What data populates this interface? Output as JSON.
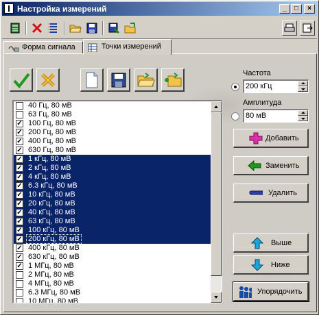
{
  "window": {
    "title": "Настройка измерений"
  },
  "titlebar_buttons": [
    "_",
    "□",
    "×"
  ],
  "toolbar": {
    "tools": [
      {
        "name": "board-icon"
      },
      {
        "name": "delete-icon"
      },
      {
        "name": "list-icon"
      },
      {
        "name": "open-folder-icon"
      },
      {
        "name": "save-icon"
      },
      {
        "name": "save-as-icon"
      },
      {
        "name": "export-folder-icon"
      }
    ],
    "right_tools": [
      {
        "name": "print-icon"
      },
      {
        "name": "exit-icon"
      }
    ]
  },
  "tabs": [
    {
      "label": "Форма сигнала",
      "active": false
    },
    {
      "label": "Точки измерений",
      "active": true
    }
  ],
  "panel_buttons": [
    {
      "name": "check-all-icon"
    },
    {
      "name": "uncheck-all-icon"
    },
    {
      "name": "new-file-icon"
    },
    {
      "name": "save-disk-icon"
    },
    {
      "name": "open-folder-icon"
    },
    {
      "name": "add-folder-icon"
    }
  ],
  "list": {
    "items": [
      {
        "label": "40 Гц, 80 мВ",
        "checked": false,
        "selected": false
      },
      {
        "label": "63 Гц, 80 мВ",
        "checked": false,
        "selected": false
      },
      {
        "label": "100 Гц, 80 мВ",
        "checked": true,
        "selected": false
      },
      {
        "label": "200 Гц, 80 мВ",
        "checked": true,
        "selected": false
      },
      {
        "label": "400 Гц, 80 мВ",
        "checked": true,
        "selected": false
      },
      {
        "label": "630 Гц, 80 мВ",
        "checked": true,
        "selected": false
      },
      {
        "label": "1 кГц, 80 мВ",
        "checked": true,
        "selected": true
      },
      {
        "label": "2 кГц, 80 мВ",
        "checked": true,
        "selected": true
      },
      {
        "label": "4 кГц, 80 мВ",
        "checked": true,
        "selected": true
      },
      {
        "label": "6.3 кГц, 80 мВ",
        "checked": true,
        "selected": true
      },
      {
        "label": "10 кГц, 80 мВ",
        "checked": true,
        "selected": true
      },
      {
        "label": "20 кГц, 80 мВ",
        "checked": true,
        "selected": true
      },
      {
        "label": "40 кГц, 80 мВ",
        "checked": true,
        "selected": true
      },
      {
        "label": "63 кГц, 80 мВ",
        "checked": true,
        "selected": true
      },
      {
        "label": "100 кГц, 80 мВ",
        "checked": true,
        "selected": true
      },
      {
        "label": "200 кГц, 80 мВ",
        "checked": true,
        "selected": true,
        "focus": true
      },
      {
        "label": "400 кГц, 80 мВ",
        "checked": true,
        "selected": false
      },
      {
        "label": "630 кГц, 80 мВ",
        "checked": true,
        "selected": false
      },
      {
        "label": "1 МГц, 80 мВ",
        "checked": true,
        "selected": false
      },
      {
        "label": "2 МГц, 80 мВ",
        "checked": false,
        "selected": false
      },
      {
        "label": "4 МГц, 80 мВ",
        "checked": false,
        "selected": false
      },
      {
        "label": "6.3 МГц, 80 мВ",
        "checked": false,
        "selected": false
      },
      {
        "label": "10 МГц, 80 мВ",
        "checked": false,
        "selected": false
      }
    ]
  },
  "frequency": {
    "label": "Частота",
    "value": "200 кГц",
    "selected": true
  },
  "amplitude": {
    "label": "Амплитуда",
    "value": "80 мВ",
    "selected": false
  },
  "actions": {
    "add": "Добавить",
    "replace": "Заменить",
    "delete": "Удалить",
    "up": "Выше",
    "down": "Ниже",
    "sort": "Упорядочить"
  }
}
